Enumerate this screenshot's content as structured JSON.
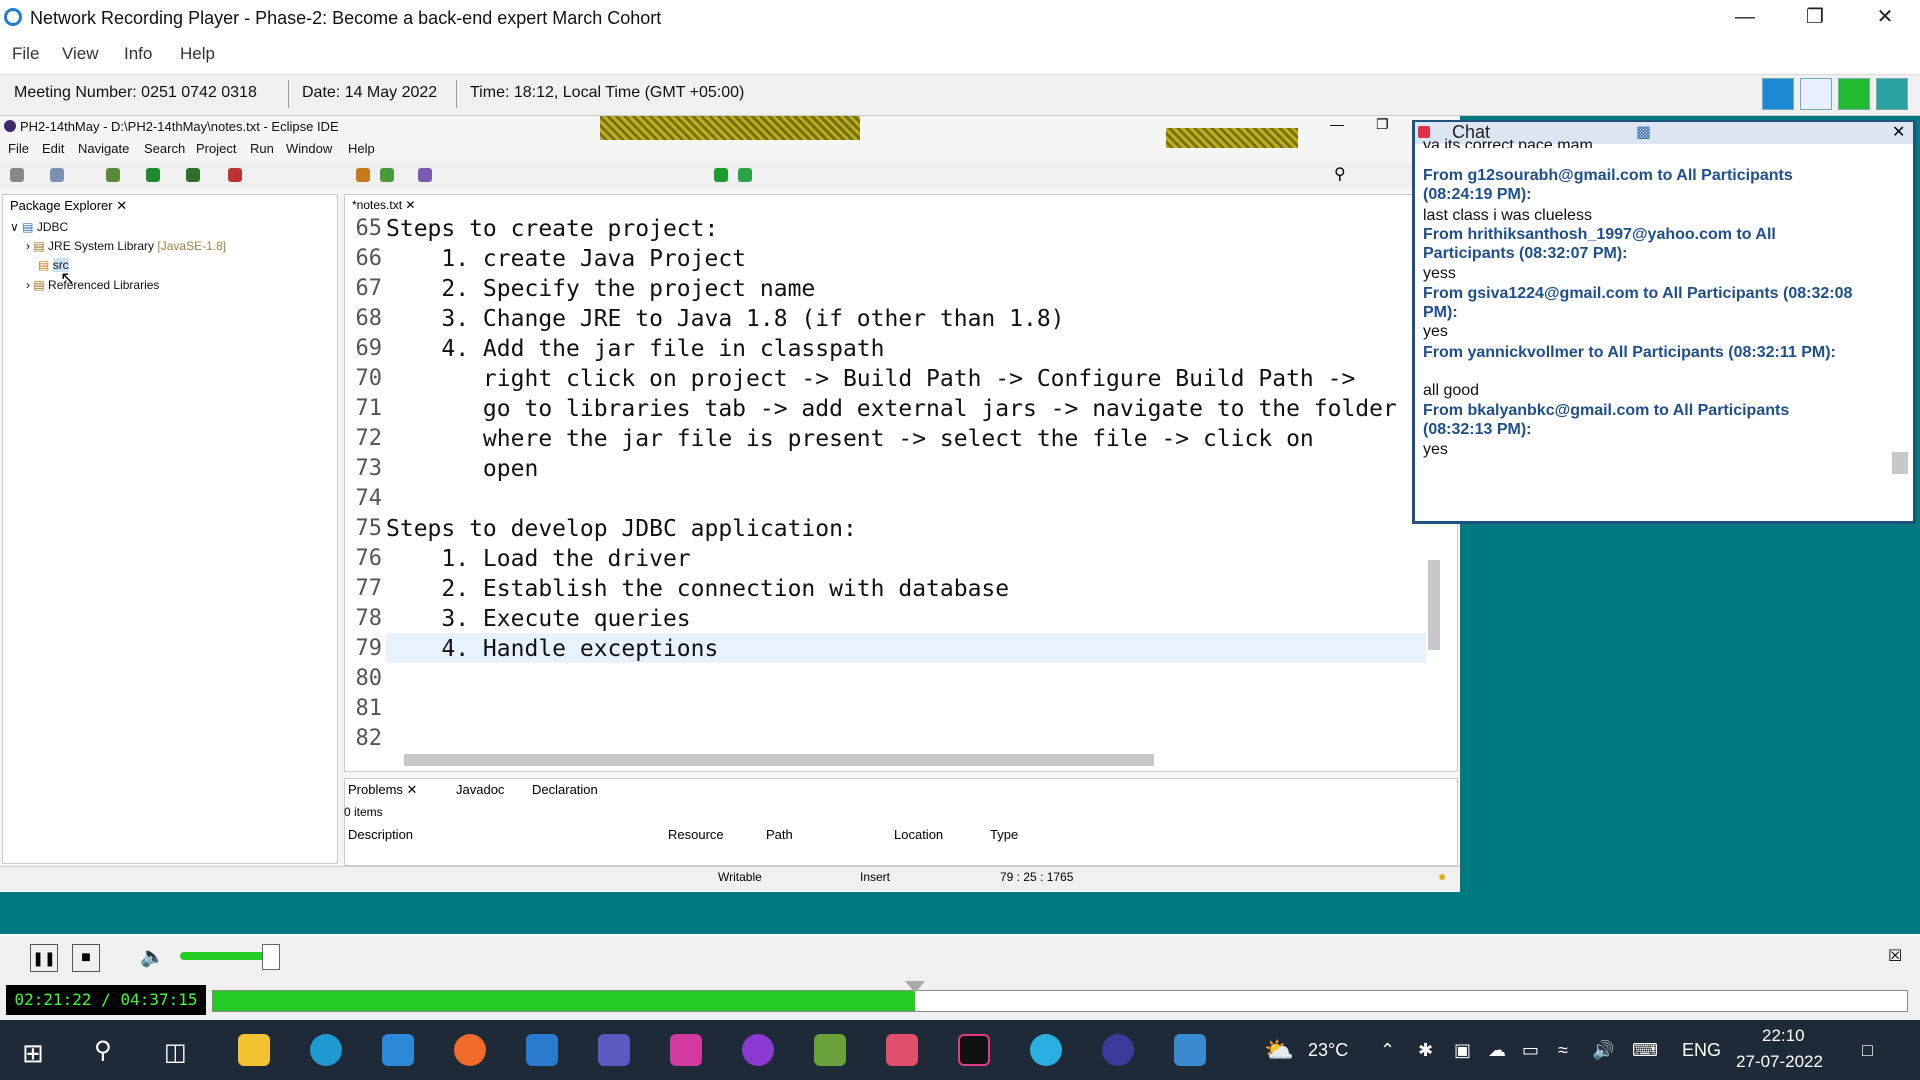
{
  "player": {
    "title": "Network Recording Player - Phase-2: Become a back-end expert March Cohort",
    "menu": [
      "File",
      "View",
      "Info",
      "Help"
    ],
    "meeting_number": "Meeting Number: 0251 0742 0318",
    "date": "Date: 14 May 2022",
    "time": "Time: 18:12, Local Time (GMT +05:00)"
  },
  "eclipse": {
    "title": "PH2-14thMay - D:\\PH2-14thMay\\notes.txt - Eclipse IDE",
    "menu": [
      "File",
      "Edit",
      "Navigate",
      "Search",
      "Project",
      "Run",
      "Window",
      "Help"
    ],
    "package_explorer": {
      "tab": "Package Explorer",
      "tree": [
        "JDBC",
        "JRE System Library",
        "[JavaSE-1.8]",
        "src",
        "Referenced Libraries"
      ]
    },
    "editor_tab": "*notes.txt",
    "code_lines": [
      {
        "n": "65",
        "t": "Steps to create project:"
      },
      {
        "n": "66",
        "t": "    1. create Java Project"
      },
      {
        "n": "67",
        "t": "    2. Specify the project name"
      },
      {
        "n": "68",
        "t": "    3. Change JRE to Java 1.8 (if other than 1.8)"
      },
      {
        "n": "69",
        "t": "    4. Add the jar file in classpath"
      },
      {
        "n": "70",
        "t": "       right click on project -> Build Path -> Configure Build Path ->"
      },
      {
        "n": "71",
        "t": "       go to libraries tab -> add external jars -> navigate to the folder"
      },
      {
        "n": "72",
        "t": "       where the jar file is present -> select the file -> click on"
      },
      {
        "n": "73",
        "t": "       open"
      },
      {
        "n": "74",
        "t": ""
      },
      {
        "n": "75",
        "t": "Steps to develop JDBC application:"
      },
      {
        "n": "76",
        "t": "    1. Load the driver"
      },
      {
        "n": "77",
        "t": "    2. Establish the connection with database"
      },
      {
        "n": "78",
        "t": "    3. Execute queries"
      },
      {
        "n": "79",
        "t": "    4. Handle exceptions"
      },
      {
        "n": "80",
        "t": ""
      },
      {
        "n": "81",
        "t": ""
      },
      {
        "n": "82",
        "t": ""
      }
    ],
    "problems": {
      "tabs": [
        "Problems",
        "Javadoc",
        "Declaration"
      ],
      "count": "0 items",
      "columns": [
        "Description",
        "Resource",
        "Path",
        "Location",
        "Type"
      ]
    },
    "status": {
      "writable": "Writable",
      "insert": "Insert",
      "position": "79 : 25 : 1765"
    }
  },
  "chat": {
    "title": "Chat",
    "partial_top": "ya its correct pace mam",
    "messages": [
      {
        "from": "From g12sourabh@gmail.com to All Participants (08:24:19 PM):",
        "text": "last class i was clueless"
      },
      {
        "from": "From hrithiksanthosh_1997@yahoo.com to All Participants (08:32:07 PM):",
        "text": "yess"
      },
      {
        "from": "From gsiva1224@gmail.com to All Participants (08:32:08 PM):",
        "text": "yes"
      },
      {
        "from": "From yannickvollmer to All Participants (08:32:11 PM):",
        "text": "all good"
      },
      {
        "from": "From bkalyanbkc@gmail.com to All Participants (08:32:13 PM):",
        "text": "yes"
      }
    ]
  },
  "playback": {
    "time": "02:21:22 / 04:37:15",
    "progress_fraction": 0.415,
    "volume_fraction": 0.85
  },
  "taskbar": {
    "weather": "23°C",
    "lang": "ENG",
    "clock_time": "22:10",
    "clock_date": "27-07-2022"
  },
  "colors": {
    "teal": "#007a82",
    "chat_sender": "#1f4f8b",
    "progress": "#22cc22"
  }
}
